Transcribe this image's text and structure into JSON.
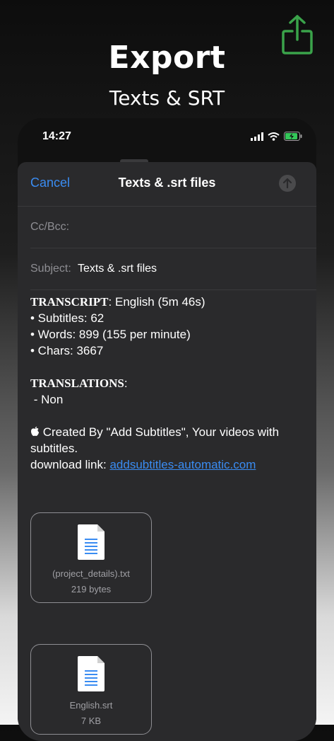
{
  "header": {
    "title": "Export",
    "subtitle": "Texts & SRT"
  },
  "status_bar": {
    "time": "14:27"
  },
  "compose": {
    "cancel_label": "Cancel",
    "title": "Texts & .srt files",
    "cc_label": "Cc/Bcc:",
    "subject_label": "Subject:",
    "subject_value": "Texts & .srt files"
  },
  "body": {
    "transcript_heading": "TRANSCRIPT",
    "transcript_value": ": English (5m 46s)",
    "subtitles": "• Subtitles: 62",
    "words": "• Words: 899 (155 per minute)",
    "chars": "• Chars: 3667",
    "translations_heading": "TRANSLATIONS",
    "translations_colon": ":",
    "translations_value": " - Non",
    "created_by": " Created By \"Add Subtitles\", Your videos with subtitles.",
    "download_label": "download link: ",
    "download_link": "addsubtitles-automatic.com"
  },
  "attachments": [
    {
      "name": "(project_details).txt",
      "size": "219 bytes"
    },
    {
      "name": "English.srt",
      "size": "7 KB"
    }
  ],
  "icons": {
    "share": "share-icon",
    "signal": "signal-icon",
    "wifi": "wifi-icon",
    "battery": "battery-icon",
    "send": "send-arrow-icon",
    "apple": "apple-icon",
    "document": "document-icon"
  },
  "colors": {
    "accent": "#3a8cf2",
    "share_green": "#3aa34a",
    "sheet": "#2a2a2c"
  }
}
